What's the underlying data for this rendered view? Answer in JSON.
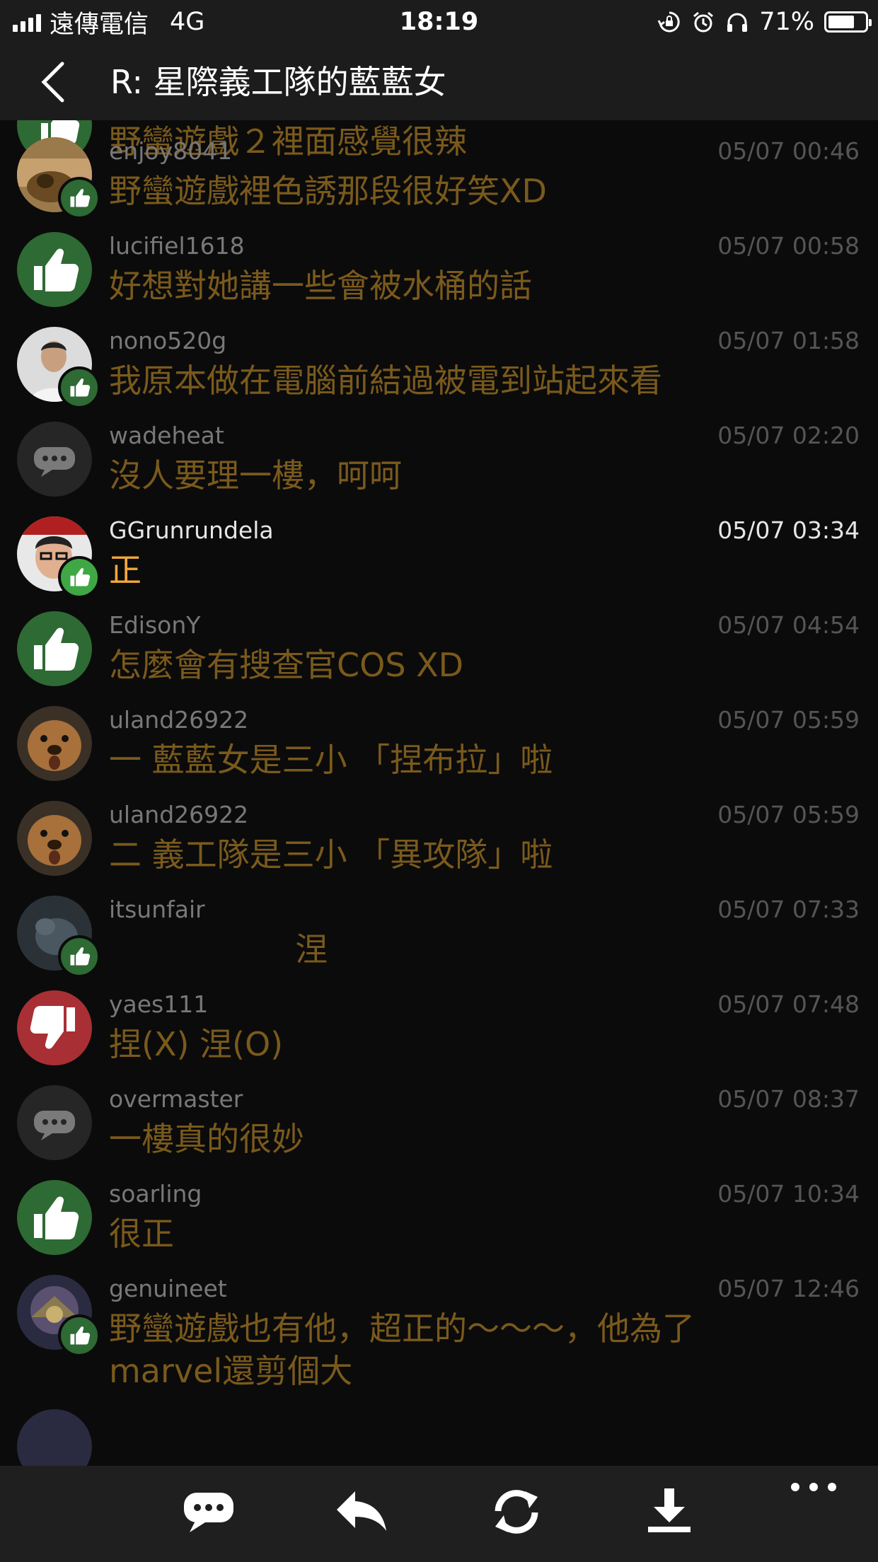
{
  "status_bar": {
    "carrier": "遠傳電信",
    "network": "4G",
    "time": "18:19",
    "battery_percent": "71%",
    "battery_level": 0.71,
    "icons": [
      "signal-icon",
      "rotation-lock-icon",
      "alarm-icon",
      "headphones-icon",
      "battery-icon"
    ]
  },
  "header": {
    "title": "R: 星際義工隊的藍藍女"
  },
  "comments": [
    {
      "user": "",
      "time": "",
      "content": "野蠻遊戲２裡面感覺很辣",
      "avatar": "like-icon"
    },
    {
      "user": "enjoy8041",
      "time": "05/07 00:46",
      "content": "野蠻遊戲裡色誘那段很好笑XD",
      "avatar": "photo"
    },
    {
      "user": "lucifiel1618",
      "time": "05/07 00:58",
      "content": "好想對她講一些會被水桶的話",
      "avatar": "like-icon"
    },
    {
      "user": "nono520g",
      "time": "05/07 01:58",
      "content": "我原本做在電腦前結過被電到站起來看",
      "avatar": "photo"
    },
    {
      "user": "wadeheat",
      "time": "05/07 02:20",
      "content": "沒人要理一樓，呵呵",
      "avatar": "comment-icon"
    },
    {
      "user": "GGrunrundela",
      "time": "05/07 03:34",
      "content": "正",
      "avatar": "photo"
    },
    {
      "user": "EdisonY",
      "time": "05/07 04:54",
      "content": "怎麼會有搜查官COS XD",
      "avatar": "like-icon"
    },
    {
      "user": "uland26922",
      "time": "05/07 05:59",
      "content": "一 藍藍女是三小 「捏布拉」啦",
      "avatar": "photo"
    },
    {
      "user": "uland26922",
      "time": "05/07 05:59",
      "content": "二 義工隊是三小 「異攻隊」啦",
      "avatar": "photo"
    },
    {
      "user": "itsunfair",
      "time": "05/07 07:33",
      "content": "                  涅",
      "avatar": "photo"
    },
    {
      "user": "yaes111",
      "time": "05/07 07:48",
      "content": "捏(X) 涅(O)",
      "avatar": "dislike-icon"
    },
    {
      "user": "overmaster",
      "time": "05/07 08:37",
      "content": "一樓真的很妙",
      "avatar": "comment-icon"
    },
    {
      "user": "soarling",
      "time": "05/07 10:34",
      "content": "很正",
      "avatar": "like-icon"
    },
    {
      "user": "genuineet",
      "time": "05/07 12:46",
      "content": "野蠻遊戲也有他，超正的～～～，他為了marvel還剪個大",
      "avatar": "photo"
    }
  ],
  "toolbar": {
    "buttons": [
      "comment-icon",
      "reply-icon",
      "refresh-icon",
      "download-icon",
      "more-icon"
    ]
  }
}
